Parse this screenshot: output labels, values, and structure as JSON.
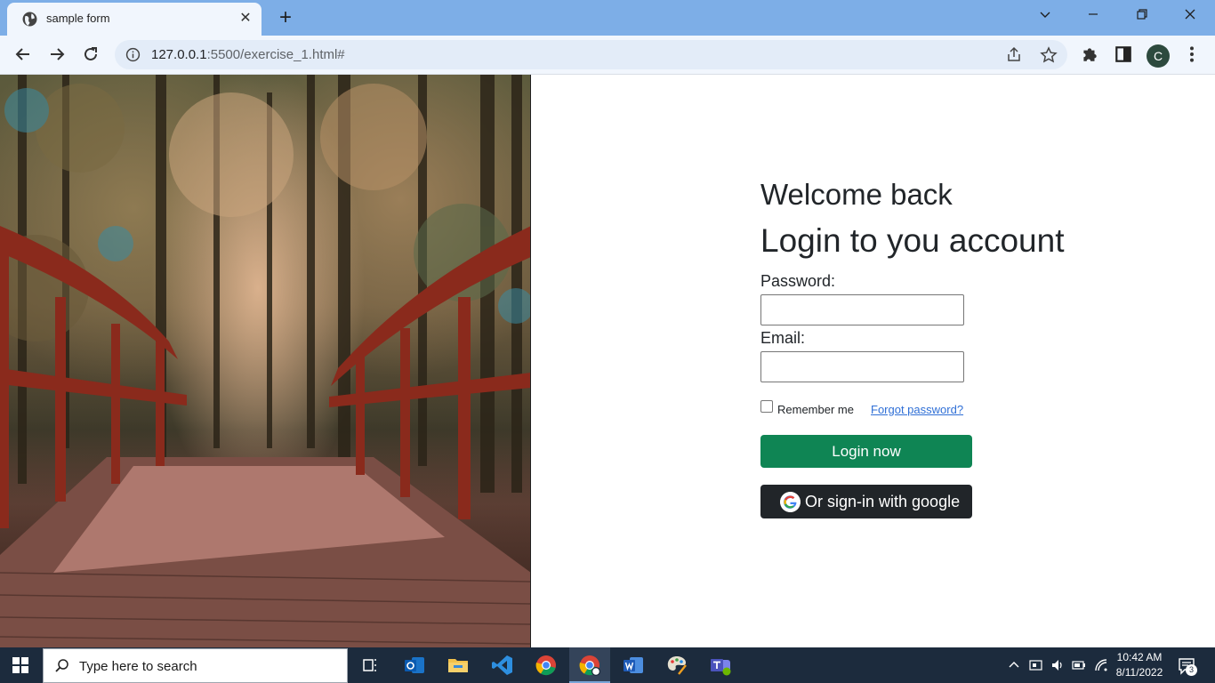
{
  "browser": {
    "tab_title": "sample form",
    "url_host": "127.0.0.1",
    "url_rest": ":5500/exercise_1.html#",
    "avatar_letter": "C"
  },
  "form": {
    "welcome": "Welcome back",
    "heading": "Login to you account",
    "password_label": "Password:",
    "password_value": "",
    "email_label": "Email:",
    "email_value": "",
    "remember_label": "Remember me",
    "remember_checked": false,
    "forgot_link": "Forgot password?",
    "login_button": "Login now",
    "google_button": "Or sign-in with google"
  },
  "taskbar": {
    "search_placeholder": "Type here to search",
    "time": "10:42 AM",
    "date": "8/11/2022",
    "notification_count": "3"
  },
  "colors": {
    "login_button": "#0f8554",
    "google_button": "#212529",
    "link": "#2f6fd6",
    "tabstrip": "#7daee7",
    "taskbar": "#1c2b3d"
  }
}
